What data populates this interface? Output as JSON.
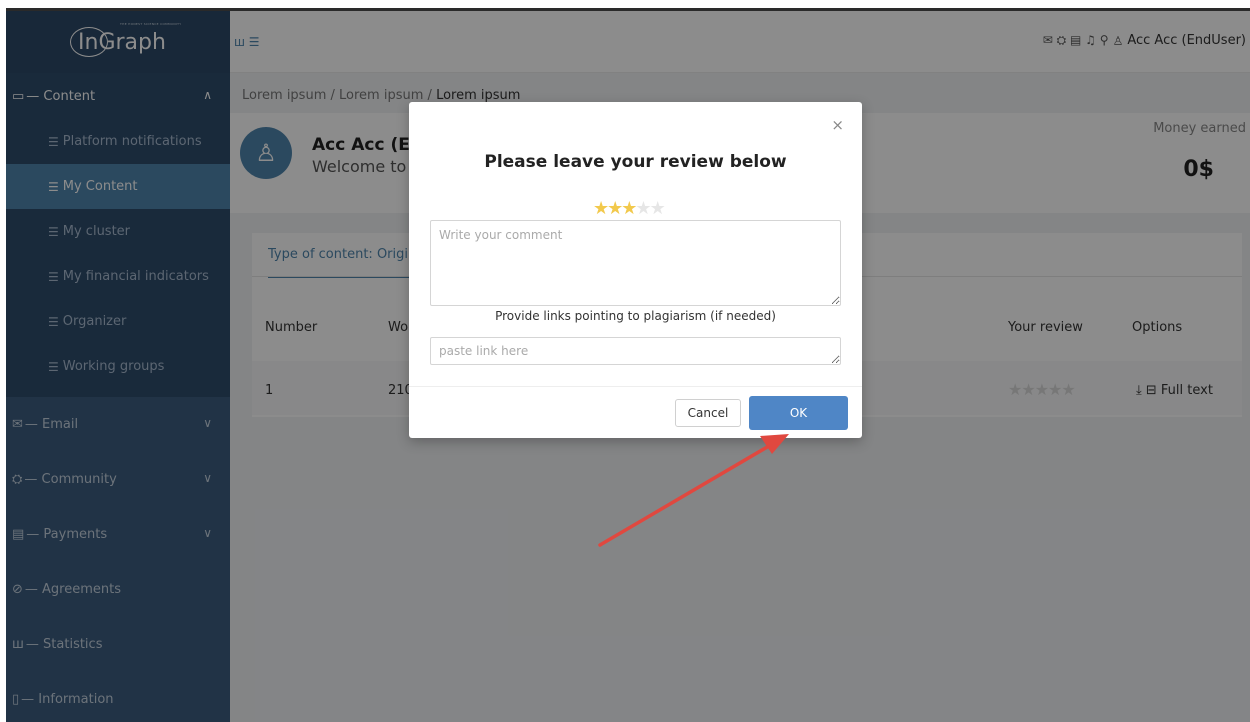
{
  "logo": {
    "text": "InGraph",
    "tagline": "THE HONEST SCIENCE COMMUNITY"
  },
  "header": {
    "left_icons": "ш ☰",
    "right_icons": "✉ ⛭ ▤ ♫ ⚲",
    "user_icon": "♙",
    "user_name": "Acc Acc (EndUser)"
  },
  "sidebar": {
    "content_section": {
      "icon": "▭",
      "label": "— Content",
      "arrow": "∧"
    },
    "content_items": [
      {
        "icon": "☰",
        "label": "Platform notifications",
        "active": false
      },
      {
        "icon": "☰",
        "label": "My Content",
        "active": true
      },
      {
        "icon": "☰",
        "label": "My cluster",
        "active": false
      },
      {
        "icon": "☰",
        "label": "My financial indicators",
        "active": false
      },
      {
        "icon": "☰",
        "label": "Organizer",
        "active": false
      },
      {
        "icon": "☰",
        "label": "Working groups",
        "active": false
      }
    ],
    "sections": [
      {
        "icon": "✉",
        "label": "— Email",
        "arrow": "∨"
      },
      {
        "icon": "⛭",
        "label": "— Community",
        "arrow": "∨"
      },
      {
        "icon": "▤",
        "label": "— Payments",
        "arrow": "∨"
      },
      {
        "icon": "⊘",
        "label": "— Agreements",
        "arrow": ""
      },
      {
        "icon": "ш",
        "label": "— Statistics",
        "arrow": ""
      },
      {
        "icon": "▯",
        "label": "— Information",
        "arrow": ""
      }
    ]
  },
  "breadcrumb": {
    "parts": [
      "Lorem ipsum",
      "Lorem ipsum",
      "Lorem ipsum"
    ],
    "sep": " / "
  },
  "profile": {
    "name": "Acc Acc (E",
    "welcome": "Welcome to",
    "money_label": "Money earned",
    "money_value": "0$"
  },
  "table": {
    "tab_label": "Type of content: Origin",
    "headers": {
      "number": "Number",
      "wo": "Wo",
      "your_review": "Your review",
      "options": "Options"
    },
    "row": {
      "number": "1",
      "wo": "210",
      "review_stars": "★★★★★",
      "options": "⤓ ⊟ Full text"
    }
  },
  "modal": {
    "close": "×",
    "title": "Please leave your review below",
    "rating": 3,
    "max_rating": 5,
    "comment_placeholder": "Write your comment",
    "links_label": "Provide links pointing to plagiarism (if needed)",
    "link_placeholder": "paste link here",
    "cancel_label": "Cancel",
    "ok_label": "OK"
  },
  "colors": {
    "sidebar_bg": "#3c5d80",
    "sidebar_active": "#4f86ad",
    "accent": "#4f86c6",
    "star_on": "#f2c94c",
    "annotation_arrow": "#e0483f"
  }
}
